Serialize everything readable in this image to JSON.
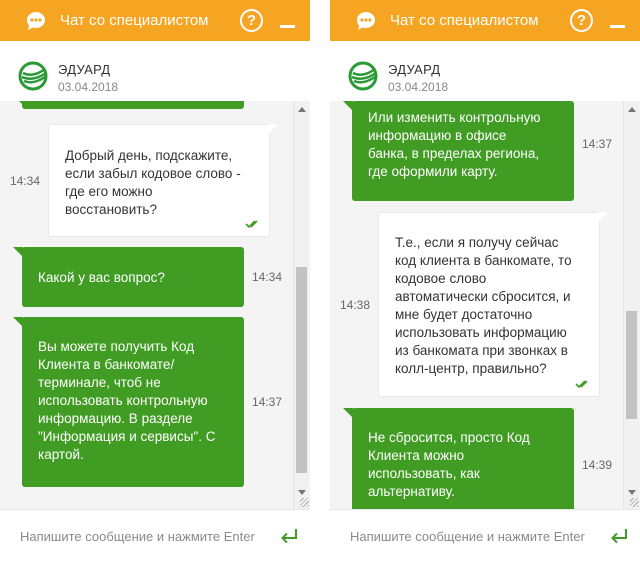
{
  "header": {
    "title": "Чат со специалистом",
    "help_label": "?"
  },
  "agent": {
    "name": "ЭДУАРД",
    "date": "03.04.2018"
  },
  "input": {
    "placeholder": "Напишите сообщение и нажмите Enter"
  },
  "icons": {
    "chat": "chat-bubble-icon",
    "help": "help-icon",
    "minimize": "minimize-icon",
    "logo": "sberbank-logo",
    "read": "double-check-icon",
    "send": "enter-arrow-icon"
  },
  "colors": {
    "header": "#f6a523",
    "agent_bubble": "#409c22",
    "user_bubble": "#ffffff",
    "chat_background": "#f4f4f4",
    "read_check": "#409c22"
  },
  "panels": [
    {
      "messages": [
        {
          "from": "user",
          "time": "14:34",
          "text": "Добрый день, подскажите,\nесли забыл кодовое слово -\nгде его можно\nвосстановить?",
          "read": true
        },
        {
          "from": "agent",
          "time": "14:34",
          "text": "Какой у вас вопрос?"
        },
        {
          "from": "agent",
          "time": "14:37",
          "text": "Вы можете получить Код\nКлиента в банкомате/\nтерминале, чтоб не\nиспользовать контрольную\nинформацию. В разделе\n\"Информация и сервисы\". С\nкартой."
        }
      ]
    },
    {
      "messages": [
        {
          "from": "agent",
          "time": "14:37",
          "text": "Или изменить контрольную\nинформацию в офисе\nбанка, в пределах региона,\nгде оформили карту."
        },
        {
          "from": "user",
          "time": "14:38",
          "text": "Т.е., если я получу сейчас\nкод клиента в банкомате, то\nкодовое слово\nавтоматически сбросится, и\nмне будет достаточно\nиспользовать информацию\nиз банкомата при звонках в\nколл-центр, правильно?",
          "read": true
        },
        {
          "from": "agent",
          "time": "14:39",
          "text": "Не сбросится, просто Код\nКлиента можно\nиспользовать, как\nальтернативу."
        }
      ]
    }
  ]
}
